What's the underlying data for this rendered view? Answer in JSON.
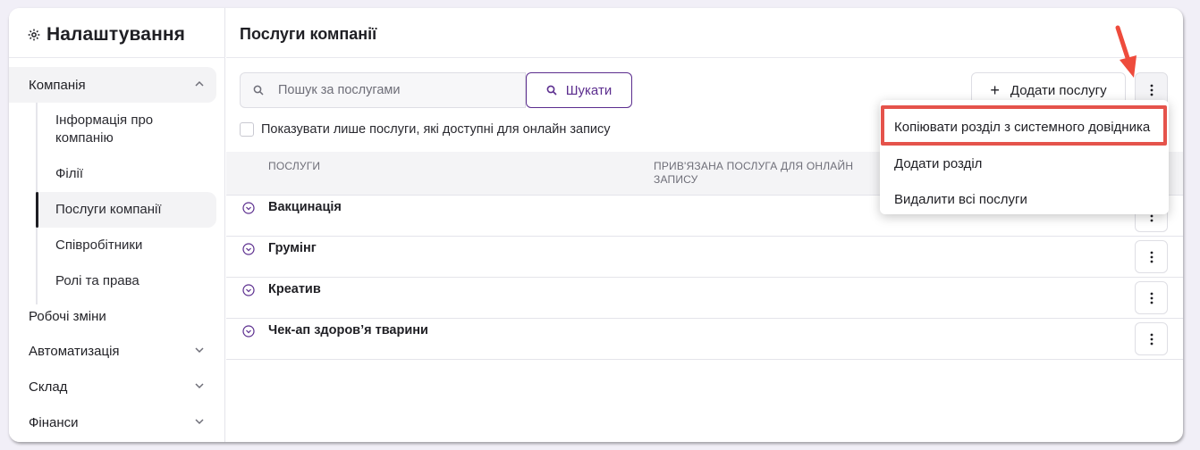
{
  "sidebar": {
    "title": "Налаштування",
    "items": [
      {
        "label": "Компанія",
        "expanded": true
      },
      {
        "label": "Робочі зміни"
      },
      {
        "label": "Автоматизація"
      },
      {
        "label": "Склад"
      },
      {
        "label": "Фінанси"
      }
    ],
    "company_sub": [
      {
        "label": "Інформація про компанію"
      },
      {
        "label": "Філії"
      },
      {
        "label": "Послуги компанії",
        "active": true
      },
      {
        "label": "Співробітники"
      },
      {
        "label": "Ролі та права"
      }
    ]
  },
  "main": {
    "title": "Послуги компанії",
    "search": {
      "placeholder": "Пошук за послугами",
      "button_label": "Шукати"
    },
    "online_only_checkbox": "Показувати лише послуги, які доступні для онлайн запису",
    "add_button_label": "Додати послугу",
    "table": {
      "headers": [
        "Послуги",
        "Прив'язана послуга для онлайн запису"
      ],
      "rows": [
        "Вакцинація",
        "Грумінг",
        "Креатив",
        "Чек-ап здоров’я тварини"
      ]
    }
  },
  "menu": {
    "items": [
      "Копіювати розділ з системного довідника",
      "Додати розділ",
      "Видалити всі послуги"
    ]
  },
  "colors": {
    "accent": "#5b2d8e",
    "highlight": "#e5534b"
  }
}
